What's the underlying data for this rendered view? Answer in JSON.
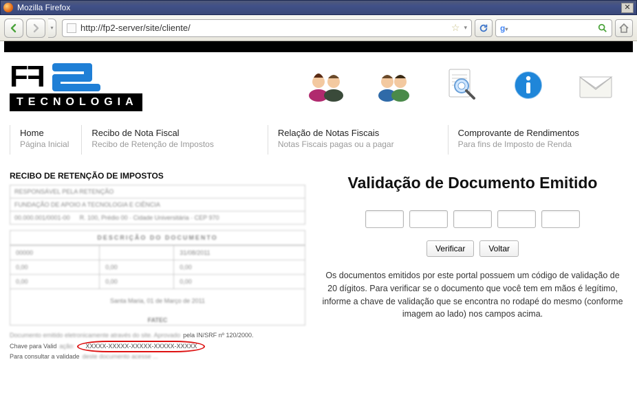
{
  "window": {
    "title": "Mozilla Firefox",
    "url": "http://fp2-server/site/cliente/"
  },
  "logo": {
    "brand": "FP2",
    "tagline": "TECNOLOGIA"
  },
  "nav": [
    {
      "title": "Home",
      "subtitle": "Página Inicial"
    },
    {
      "title": "Recibo de Nota Fiscal",
      "subtitle": "Recibo de Retenção de Impostos"
    },
    {
      "title": "Relação de Notas Fiscais",
      "subtitle": "Notas Fiscais pagas ou a pagar"
    },
    {
      "title": "Comprovante de Rendimentos",
      "subtitle": "Para fins de Imposto de Renda"
    }
  ],
  "left": {
    "heading": "RECIBO DE RETENÇÃO DE IMPOSTOS",
    "foot_line1_suffix": "pela IN/SRF nº 120/2000.",
    "foot_line2_prefix": "Chave para Valid",
    "foot_key": "XXXXX-XXXXX-XXXXX-XXXXX-XXXXX",
    "foot_line3_prefix": "Para consultar a validade"
  },
  "right": {
    "heading": "Validação de Documento Emitido",
    "verify_label": "Verificar",
    "back_label": "Voltar",
    "description": "Os documentos emitidos por este portal possuem um código de validação de 20 dígitos. Para verificar se o documento que você tem em mãos é legítimo, informe a chave de validação que se encontra no rodapé do mesmo (conforme imagem ao lado) nos campos acima."
  }
}
